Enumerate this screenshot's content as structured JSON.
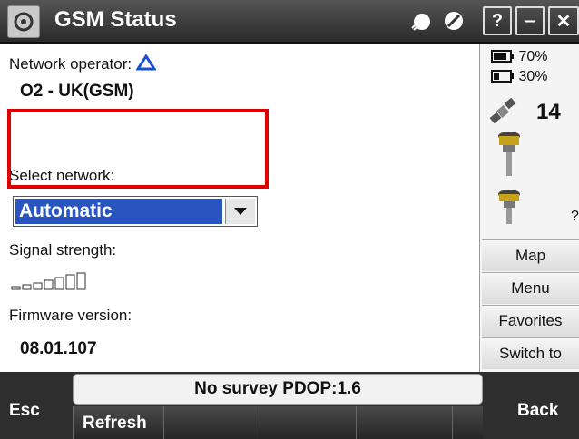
{
  "title_bar": {
    "title": "GSM Status",
    "app_icon": "gear-icon",
    "help_label": "?",
    "minimize_label": "–",
    "close_label": "✕"
  },
  "main": {
    "network_operator_label": "Network operator:",
    "network_operator_value": "O2 - UK(GSM)",
    "select_network_label": "Select network:",
    "select_network_value": "Automatic",
    "signal_strength_label": "Signal strength:",
    "signal_strength_bars": 0,
    "firmware_label": "Firmware version:",
    "firmware_value": "08.01.107"
  },
  "side_panel": {
    "battery_1": "70%",
    "battery_2": "30%",
    "satellites": "14",
    "receiver_2_status": "?",
    "buttons": [
      "Map",
      "Menu",
      "Favorites",
      "Switch to"
    ]
  },
  "bottom_bar": {
    "status_text": "No survey  PDOP:1.6",
    "esc_label": "Esc",
    "refresh_label": "Refresh",
    "back_label": "Back"
  },
  "colors": {
    "highlight": "#2a55c0",
    "callout": "#e00000",
    "titlebar": "#3a3a3a"
  }
}
